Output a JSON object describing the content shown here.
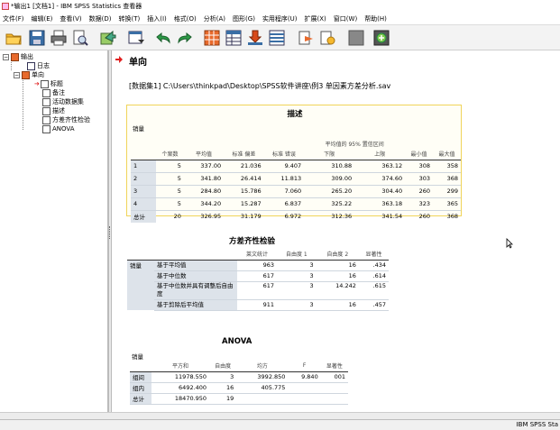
{
  "window": {
    "title": "*输出1 [文档1] - IBM SPSS Statistics 查看器"
  },
  "menu": [
    "文件(F)",
    "编辑(E)",
    "查看(V)",
    "数据(D)",
    "转换(T)",
    "插入(I)",
    "格式(O)",
    "分析(A)",
    "图形(G)",
    "实用程序(U)",
    "扩展(X)",
    "窗口(W)",
    "帮助(H)"
  ],
  "toolbar_icons": [
    "open-icon",
    "save-icon",
    "print-icon",
    "print-preview-icon",
    "export-icon",
    "recall-dialog-icon",
    "undo-icon",
    "redo-icon",
    "goto-data-icon",
    "goto-case-icon",
    "goto-variable-icon",
    "variables-icon",
    "insert-output-icon",
    "show-hide-icon",
    "disabled-icon",
    "designate-window-icon"
  ],
  "navigator": {
    "root": "输出",
    "items": [
      "日志",
      "单向",
      "标题",
      "备注",
      "活动数据集",
      "描述",
      "方差齐性检验",
      "ANOVA"
    ]
  },
  "content": {
    "procedure_title": "单向",
    "dataset_line": "[数据集1] C:\\Users\\thinkpad\\Desktop\\SPSS软件讲座\\例3 单因素方差分析.sav",
    "descriptives": {
      "title": "描述",
      "variable": "销量",
      "ci_header": "平均值的 95% 置信区间",
      "columns": [
        "个案数",
        "平均值",
        "标准 偏差",
        "标准 错误",
        "下限",
        "上限",
        "最小值",
        "最大值"
      ],
      "rows": [
        [
          "1",
          "5",
          "337.00",
          "21.036",
          "9.407",
          "310.88",
          "363.12",
          "308",
          "358"
        ],
        [
          "2",
          "5",
          "341.80",
          "26.414",
          "11.813",
          "309.00",
          "374.60",
          "303",
          "368"
        ],
        [
          "3",
          "5",
          "284.80",
          "15.786",
          "7.060",
          "265.20",
          "304.40",
          "260",
          "299"
        ],
        [
          "4",
          "5",
          "344.20",
          "15.287",
          "6.837",
          "325.22",
          "363.18",
          "323",
          "365"
        ],
        [
          "总计",
          "20",
          "326.95",
          "31.179",
          "6.972",
          "312.36",
          "341.54",
          "260",
          "368"
        ]
      ]
    },
    "levene": {
      "title": "方差齐性检验",
      "columns": [
        "莱文统计",
        "自由度 1",
        "自由度 2",
        "显著性"
      ],
      "group": "销量",
      "rows": [
        [
          "基于平均值",
          "963",
          "3",
          "16",
          ".434"
        ],
        [
          "基于中位数",
          "617",
          "3",
          "16",
          ".614"
        ],
        [
          "基于中位数并具有调整后自由度",
          "617",
          "3",
          "14.242",
          ".615"
        ],
        [
          "基于剪除后平均值",
          "911",
          "3",
          "16",
          ".457"
        ]
      ]
    },
    "anova": {
      "title": "ANOVA",
      "variable": "销量",
      "columns": [
        "平方和",
        "自由度",
        "均方",
        "F",
        "显著性"
      ],
      "rows": [
        [
          "组间",
          "11978.550",
          "3",
          "3992.850",
          "9.840",
          "001"
        ],
        [
          "组内",
          "6492.400",
          "16",
          "405.775",
          "",
          ""
        ],
        [
          "总计",
          "18470.950",
          "19",
          "",
          "",
          ""
        ]
      ]
    }
  },
  "status": {
    "text": "IBM SPSS Sta"
  }
}
